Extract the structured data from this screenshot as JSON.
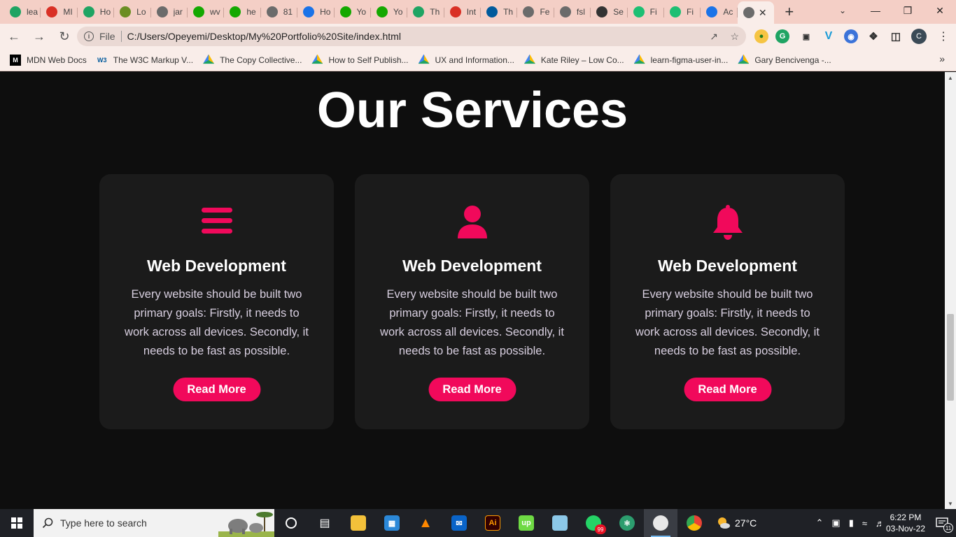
{
  "browser": {
    "tabs": [
      {
        "label": "lea",
        "icon": "google-drive-icon",
        "color": "#1fa463"
      },
      {
        "label": "MI",
        "icon": "gmail-icon",
        "color": "#d93025"
      },
      {
        "label": "Ho",
        "icon": "google-drive-icon",
        "color": "#1fa463"
      },
      {
        "label": "Lo",
        "icon": "image-icon",
        "color": "#6b8e23"
      },
      {
        "label": "jar",
        "icon": "globe-icon",
        "color": "#6b6b6b"
      },
      {
        "label": "wv",
        "icon": "upwork-icon",
        "color": "#14a800"
      },
      {
        "label": "he",
        "icon": "upwork-icon",
        "color": "#14a800"
      },
      {
        "label": "81",
        "icon": "globe-icon",
        "color": "#6b6b6b"
      },
      {
        "label": "Ho",
        "icon": "plus-cross-icon",
        "color": "#1a73e8"
      },
      {
        "label": "Yo",
        "icon": "upwork-icon",
        "color": "#14a800"
      },
      {
        "label": "Yo",
        "icon": "upwork-icon",
        "color": "#14a800"
      },
      {
        "label": "Th",
        "icon": "google-drive-icon",
        "color": "#1fa463"
      },
      {
        "label": "Int",
        "icon": "gmail-icon",
        "color": "#d93025"
      },
      {
        "label": "Th",
        "icon": "w3c-icon",
        "color": "#005a9c"
      },
      {
        "label": "Fe",
        "icon": "globe-icon",
        "color": "#6b6b6b"
      },
      {
        "label": "fsl",
        "icon": "globe-icon",
        "color": "#6b6b6b"
      },
      {
        "label": "Se",
        "icon": "gear-icon",
        "color": "#333333"
      },
      {
        "label": "Fi",
        "icon": "fiverr-icon",
        "color": "#1dbf73"
      },
      {
        "label": "Fi",
        "icon": "fiverr-icon",
        "color": "#1dbf73"
      },
      {
        "label": "Ac",
        "icon": "bookmark-icon",
        "color": "#1a73e8"
      },
      {
        "label": "",
        "icon": "globe-icon",
        "color": "#6b6b6b",
        "active": true
      }
    ],
    "new_tab": "+",
    "address": {
      "scheme": "File",
      "url": "C:/Users/Opeyemi/Desktop/My%20Portfolio%20Site/index.html"
    },
    "profile_initial": "C",
    "bookmarks": [
      {
        "label": "MDN Web Docs",
        "icon": "mdn-icon"
      },
      {
        "label": "The W3C Markup V...",
        "icon": "w3c-icon"
      },
      {
        "label": "The Copy Collective...",
        "icon": "google-drive-icon"
      },
      {
        "label": "How to Self Publish...",
        "icon": "google-drive-icon"
      },
      {
        "label": "UX and Information...",
        "icon": "google-drive-icon"
      },
      {
        "label": "Kate Riley – Low Co...",
        "icon": "google-drive-icon"
      },
      {
        "label": "learn-figma-user-in...",
        "icon": "google-drive-icon"
      },
      {
        "label": "Gary Bencivenga -...",
        "icon": "google-drive-icon"
      }
    ]
  },
  "page": {
    "title": "Our Services",
    "accent": "#f1095b",
    "cards": [
      {
        "icon": "menu-bars-icon",
        "title": "Web Development",
        "description": "Every website should be built two primary goals: Firstly, it needs to work across all devices. Secondly, it needs to be fast as possible.",
        "button": "Read More"
      },
      {
        "icon": "user-icon",
        "title": "Web Development",
        "description": "Every website should be built two primary goals: Firstly, it needs to work across all devices. Secondly, it needs to be fast as possible.",
        "button": "Read More"
      },
      {
        "icon": "bell-icon",
        "title": "Web Development",
        "description": "Every website should be built two primary goals: Firstly, it needs to work across all devices. Secondly, it needs to be fast as possible.",
        "button": "Read More"
      }
    ]
  },
  "taskbar": {
    "search_placeholder": "Type here to search",
    "weather": "27°C",
    "whatsapp_badge": "99",
    "time": "6:22 PM",
    "date": "03-Nov-22",
    "notification_count": "11",
    "apps": [
      "cortana-icon",
      "task-view-icon",
      "file-explorer-icon",
      "store-icon",
      "vlc-icon",
      "mail-icon",
      "illustrator-icon",
      "upwork-app-icon",
      "notepad-icon",
      "whatsapp-icon",
      "atom-icon",
      "paint-icon",
      "chrome-icon"
    ]
  }
}
